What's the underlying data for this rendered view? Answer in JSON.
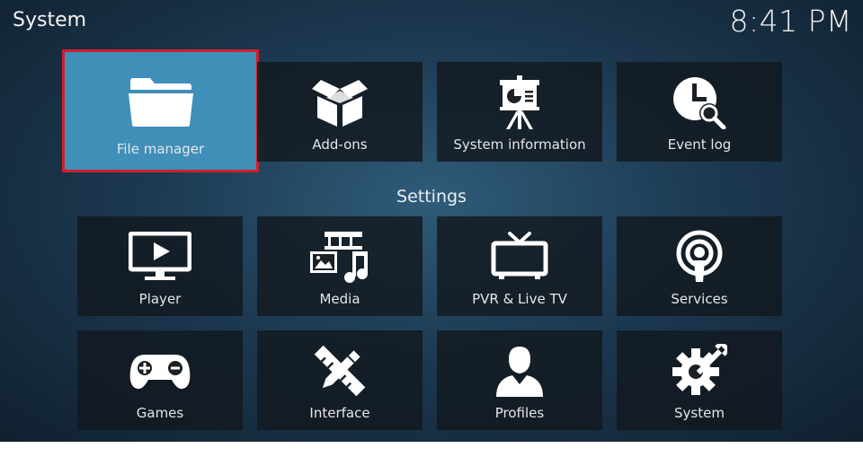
{
  "header": {
    "title": "System",
    "clock": "8:41 PM"
  },
  "top_row": [
    {
      "label": "File manager",
      "icon": "folder-icon",
      "focused": true
    },
    {
      "label": "Add-ons",
      "icon": "open-box-icon"
    },
    {
      "label": "System information",
      "icon": "presentation-easel-icon"
    },
    {
      "label": "Event log",
      "icon": "clock-search-icon"
    }
  ],
  "settings": {
    "heading": "Settings",
    "row1": [
      {
        "label": "Player",
        "icon": "monitor-play-icon"
      },
      {
        "label": "Media",
        "icon": "media-film-music-icon"
      },
      {
        "label": "PVR & Live TV",
        "icon": "tv-antenna-icon"
      },
      {
        "label": "Services",
        "icon": "podcast-broadcast-icon"
      }
    ],
    "row2": [
      {
        "label": "Games",
        "icon": "gamepad-icon"
      },
      {
        "label": "Interface",
        "icon": "pencil-ruler-icon"
      },
      {
        "label": "Profiles",
        "icon": "user-profile-icon"
      },
      {
        "label": "System",
        "icon": "gear-wrench-icon"
      }
    ]
  },
  "colors": {
    "accent": "#3f8fb9",
    "focus_outline": "#d11f2d",
    "tile_bg": "#12181e"
  }
}
